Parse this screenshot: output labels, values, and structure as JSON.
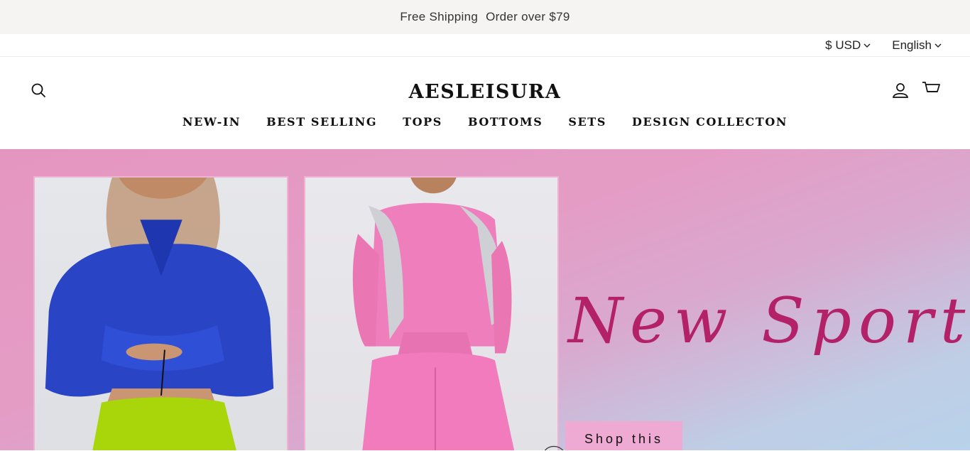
{
  "announcement": {
    "part1": "Free Shipping",
    "part2": "Order over $79"
  },
  "utility": {
    "currency": "$ USD",
    "language": "English"
  },
  "header": {
    "brand": "AESLEISURA"
  },
  "nav": {
    "items": [
      {
        "label": "NEW-IN"
      },
      {
        "label": "BEST SELLING"
      },
      {
        "label": "TOPS"
      },
      {
        "label": "BOTTOMS"
      },
      {
        "label": "SETS"
      },
      {
        "label": "DESIGN COLLECTON"
      }
    ]
  },
  "hero": {
    "headline": "New Sports",
    "cta": "Shop this",
    "colors": {
      "headline": "#b32169",
      "cta_bg": "#eeaad2",
      "bg": "#e596c0"
    }
  }
}
